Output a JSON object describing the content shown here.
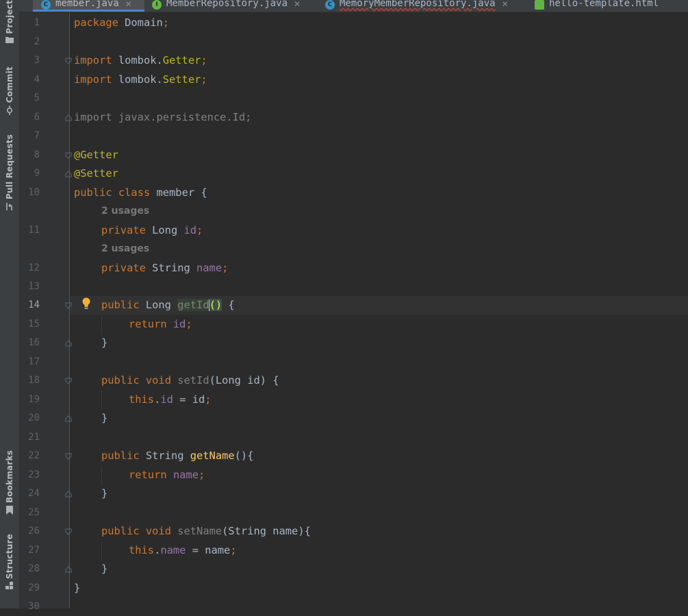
{
  "sidebar": {
    "project": "Project",
    "commit": "Commit",
    "pull_requests": "Pull Requests",
    "bookmarks": "Bookmarks",
    "structure": "Structure"
  },
  "tabs": [
    {
      "label": "member.java",
      "icon": "java-class-icon",
      "icon_letter": "C",
      "color": "#3592c4",
      "active": true
    },
    {
      "label": "MemberRepository.java",
      "icon": "java-interface-icon",
      "icon_letter": "I",
      "color": "#62b543",
      "active": false
    },
    {
      "label": "MemoryMemberRepository.java",
      "icon": "java-class-icon",
      "icon_letter": "C",
      "color": "#3592c4",
      "active": false
    },
    {
      "label": "hello-template.html",
      "icon": "html-file-icon",
      "icon_letter": "",
      "color": "#62b543",
      "active": false
    }
  ],
  "colors": {
    "background": "#2b2b2b",
    "keyword": "#cc7832",
    "annotation": "#bbb529",
    "field": "#9876aa",
    "method": "#ffc66d",
    "active_tab_underline": "#4a88c7"
  },
  "editor": {
    "line_numbers": [
      "1",
      "2",
      "3",
      "4",
      "5",
      "6",
      "7",
      "8",
      "9",
      "10",
      "11",
      "12",
      "13",
      "14",
      "15",
      "16",
      "17",
      "18",
      "19",
      "20",
      "21",
      "22",
      "23",
      "24",
      "25",
      "26",
      "27",
      "28",
      "29",
      "30"
    ],
    "current_line": "14",
    "usage_hint": "2 usages",
    "code": {
      "l1_kw": "package",
      "l1_rest": " Domain",
      "semi": ";",
      "import_kw": "import",
      "l3_pkg": " lombok.",
      "l3_cls": "Getter",
      "l4_pkg": " lombok.",
      "l4_cls": "Setter",
      "l6": "import javax.persistence.Id;",
      "l8": "@Getter",
      "l9": "@Setter",
      "public": "public",
      "private": "private",
      "class_kw": "class",
      "void": "void",
      "return": "return",
      "this": "this",
      "l10_name": " member {",
      "long_type": " Long ",
      "string_type": " String ",
      "id": "id",
      "name": "name",
      "getId": "getId",
      "setId": "setId",
      "getName": "getName",
      "setName": "setName",
      "open_paren": "(",
      "close_paren": ")",
      "parens": "()",
      "brace_open": " {",
      "brace_close": "}",
      "setId_params": "(Long id) {",
      "getName_tail": "(){",
      "setName_params": "(String name){",
      "assign_id": " = id",
      "assign_name": " = name",
      "dot": "."
    }
  }
}
